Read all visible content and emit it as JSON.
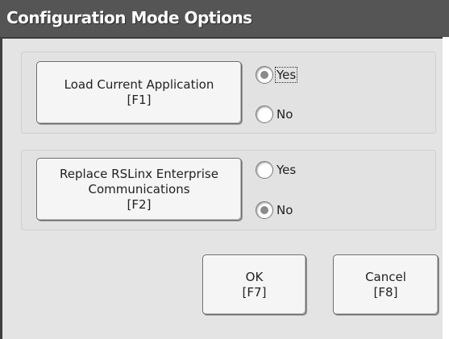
{
  "dialog": {
    "title": "Configuration Mode Options"
  },
  "options": [
    {
      "button_label": "Load Current Application\n[F1]",
      "yes_label": "Yes",
      "no_label": "No",
      "selected": "Yes"
    },
    {
      "button_label": "Replace RSLinx Enterprise\nCommunications\n[F2]",
      "yes_label": "Yes",
      "no_label": "No",
      "selected": "No"
    }
  ],
  "footer": {
    "ok_label": "OK\n[F7]",
    "cancel_label": "Cancel\n[F8]"
  }
}
